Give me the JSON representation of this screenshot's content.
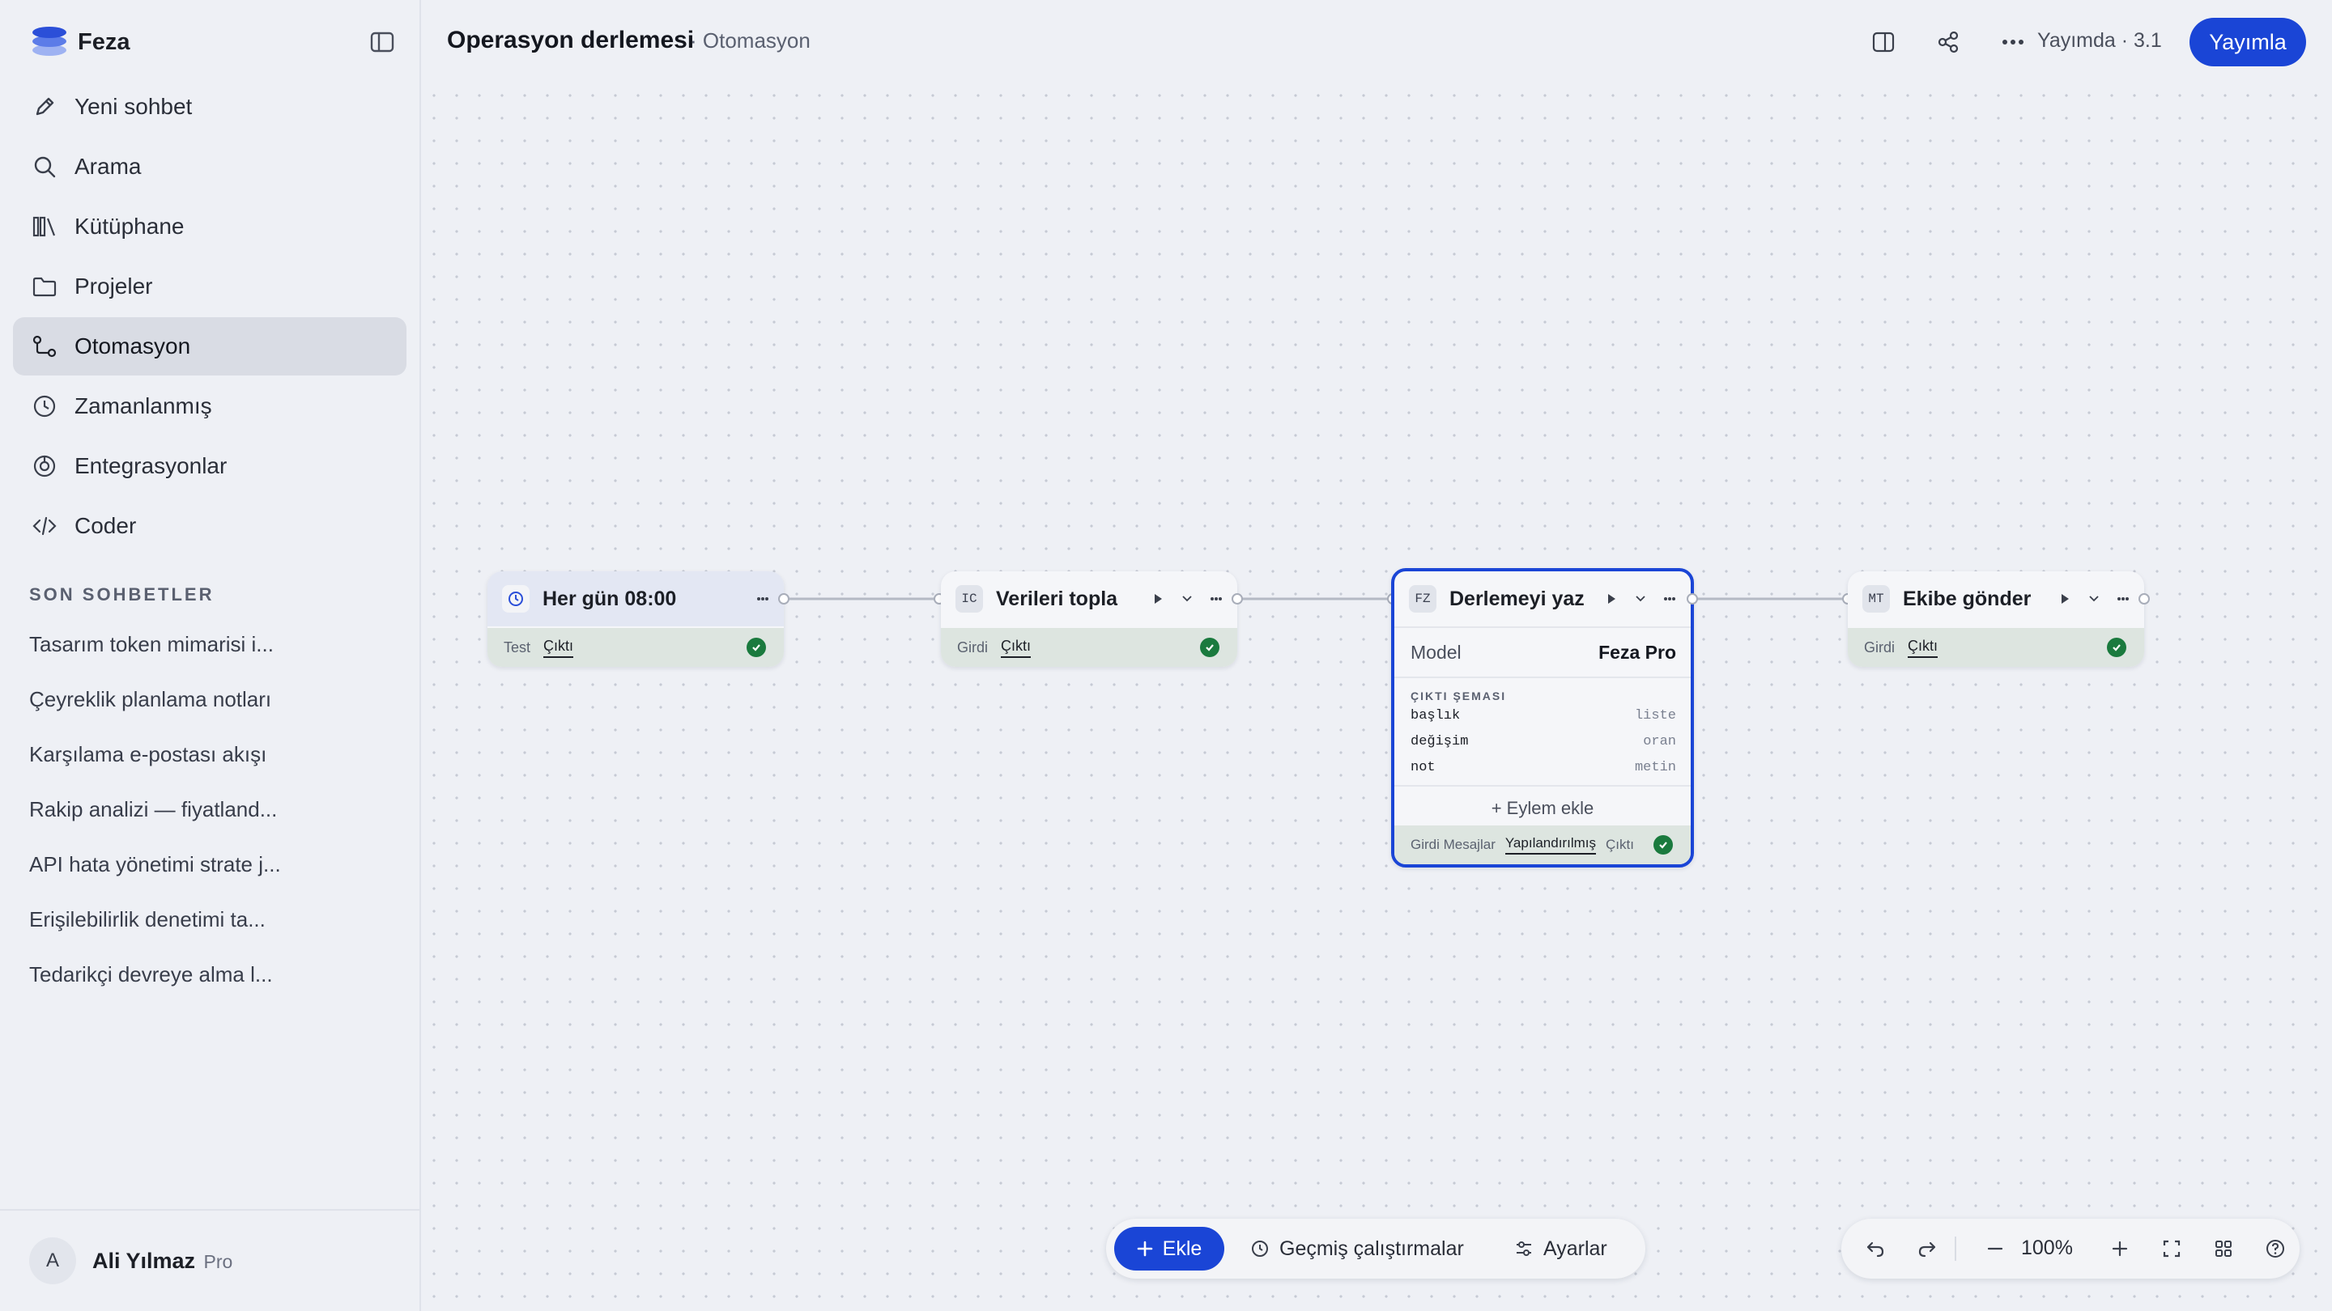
{
  "app": {
    "name": "Feza"
  },
  "nav": [
    {
      "label": "Yeni sohbet",
      "icon": "pencil-icon"
    },
    {
      "label": "Arama",
      "icon": "search-icon"
    },
    {
      "label": "Kütüphane",
      "icon": "library-icon"
    },
    {
      "label": "Projeler",
      "icon": "folder-icon"
    },
    {
      "label": "Otomasyon",
      "icon": "workflow-icon",
      "active": true
    },
    {
      "label": "Zamanlanmış",
      "icon": "clock-icon"
    },
    {
      "label": "Entegrasyonlar",
      "icon": "integration-icon"
    },
    {
      "label": "Coder",
      "icon": "code-icon"
    }
  ],
  "recent": {
    "title": "SON SOHBETLER",
    "items": [
      "Tasarım token mimarisi i...",
      "Çeyreklik planlama notları",
      "Karşılama e-postası akışı",
      "Rakip analizi — fiyatland...",
      "API hata yönetimi strate j...",
      "Erişilebilirlik denetimi ta...",
      "Tedarikçi devreye alma l..."
    ]
  },
  "user": {
    "initial": "A",
    "name": "Ali Yılmaz",
    "plan": "Pro"
  },
  "header": {
    "title": "Operasyon derlemesi",
    "breadcrumb": "· Otomasyon",
    "status": "Yayımda · 3.1",
    "publish_label": "Yayımla"
  },
  "nodes": {
    "trigger": {
      "title": "Her gün 08:00",
      "tab1": "Test",
      "tab2": "Çıktı"
    },
    "collect": {
      "badge": "IC",
      "title": "Verileri topla",
      "tab1": "Girdi",
      "tab2": "Çıktı"
    },
    "write": {
      "badge": "FZ",
      "title": "Derlemeyi yaz",
      "model_label": "Model",
      "model_value": "Feza Pro",
      "schema_title": "ÇIKTI ŞEMASI",
      "schema": [
        {
          "key": "başlık",
          "type": "liste"
        },
        {
          "key": "değişim",
          "type": "oran"
        },
        {
          "key": "not",
          "type": "metin"
        }
      ],
      "add_action": "+ Eylem ekle",
      "tab1": "Girdi Mesajlar",
      "tab2": "Yapılandırılmış",
      "tab3": "Çıktı"
    },
    "send": {
      "badge": "MT",
      "title": "Ekibe gönder",
      "tab1": "Girdi",
      "tab2": "Çıktı"
    }
  },
  "toolbar": {
    "add_label": "Ekle",
    "history_label": "Geçmiş çalıştırmalar",
    "settings_label": "Ayarlar"
  },
  "zoom": {
    "value": "100%"
  },
  "colors": {
    "accent": "#1a45d6",
    "success": "#1a7a3e"
  }
}
